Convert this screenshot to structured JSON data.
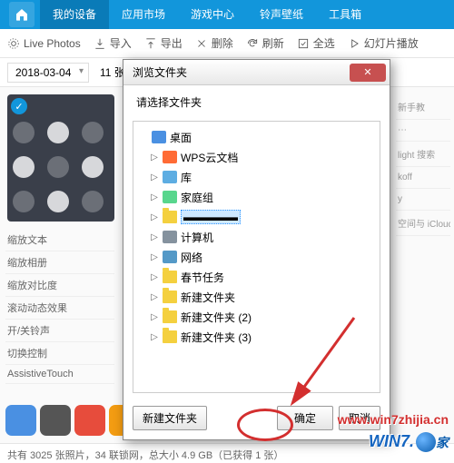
{
  "topbar": {
    "device": "我的设备",
    "tabs": [
      "应用市场",
      "游戏中心",
      "铃声壁纸",
      "工具箱"
    ]
  },
  "toolbar": {
    "live": "Live Photos",
    "import": "导入",
    "export": "导出",
    "delete": "删除",
    "refresh": "刷新",
    "selectall": "全选",
    "slideshow": "幻灯片播放"
  },
  "subbar": {
    "date": "2018-03-04",
    "count": "11 张"
  },
  "dialog": {
    "title": "浏览文件夹",
    "prompt": "请选择文件夹",
    "tree": {
      "desktop": "桌面",
      "wps": "WPS云文档",
      "lib": "库",
      "homegroup": "家庭组",
      "selected": "",
      "pc": "计算机",
      "net": "网络",
      "task": "春节任务",
      "folder1": "新建文件夹",
      "folder2": "新建文件夹 (2)",
      "folder3": "新建文件夹 (3)"
    },
    "newfolder": "新建文件夹",
    "ok": "确定",
    "cancel": "取消"
  },
  "sidepane": [
    "缩放文本",
    "缩放相册",
    "缩放对比度",
    "滚动动态效果",
    "开/关铃声",
    "切换控制",
    "AssistiveTouch"
  ],
  "rightpane": [
    "新手教",
    "⋯",
    "light 搜索",
    "koff",
    "y",
    "空间与 iCloud 用量"
  ],
  "statusbar": "共有 3025 张照片，34 联锁网，总大小 4.9 GB（已获得 1 张）",
  "watermark": "www.win7zhijia.cn",
  "logo": {
    "win": "WIN",
    "seven": "7.",
    "jia": "家"
  }
}
